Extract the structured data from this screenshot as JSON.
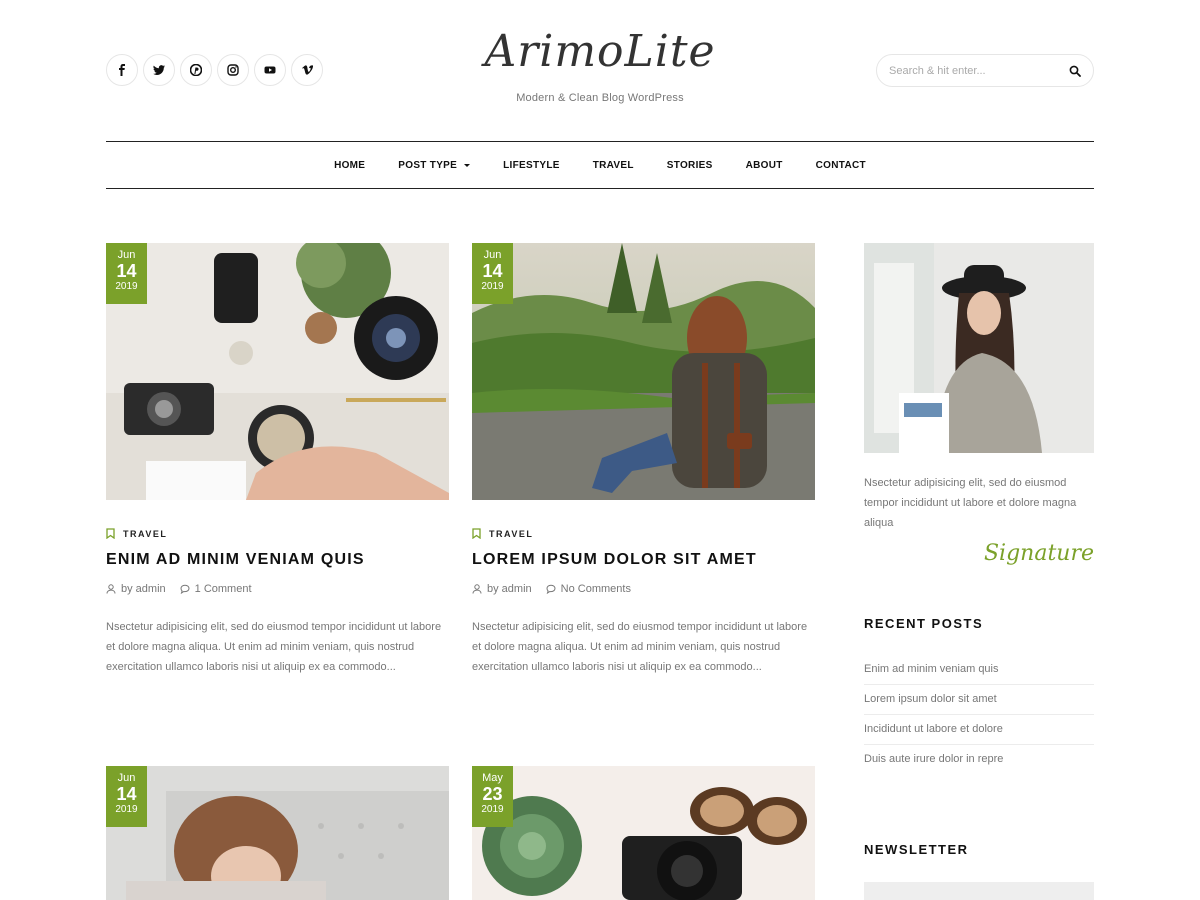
{
  "header": {
    "socials": [
      {
        "icon": "facebook-icon",
        "glyph": "f"
      },
      {
        "icon": "twitter-icon",
        "glyph": "t"
      },
      {
        "icon": "pinterest-icon",
        "glyph": "p"
      },
      {
        "icon": "instagram-icon",
        "glyph": "i"
      },
      {
        "icon": "youtube-icon",
        "glyph": "y"
      },
      {
        "icon": "vimeo-icon",
        "glyph": "v"
      }
    ],
    "logo": "ArimoLite",
    "tagline": "Modern & Clean Blog WordPress",
    "search_placeholder": "Search & hit enter..."
  },
  "nav": {
    "home": "HOME",
    "post_type": "POST TYPE",
    "lifestyle": "LIFESTYLE",
    "travel": "TRAVEL",
    "stories": "STORIES",
    "about": "ABOUT",
    "contact": "CONTACT"
  },
  "posts": [
    {
      "month": "Jun",
      "day": "14",
      "year": "2019",
      "category": "TRAVEL",
      "title": "ENIM AD MINIM VENIAM QUIS",
      "author": "by admin",
      "comments": "1 Comment",
      "excerpt": "Nsectetur adipisicing elit, sed do eiusmod tempor incididunt ut labore et dolore magna aliqua. Ut enim ad minim veniam, quis nostrud exercitation ullamco laboris nisi ut aliquip ex ea commodo..."
    },
    {
      "month": "Jun",
      "day": "14",
      "year": "2019",
      "category": "TRAVEL",
      "title": "LOREM IPSUM DOLOR SIT AMET",
      "author": "by admin",
      "comments": "No Comments",
      "excerpt": "Nsectetur adipisicing elit, sed do eiusmod tempor incididunt ut labore et dolore magna aliqua. Ut enim ad minim veniam, quis nostrud exercitation ullamco laboris nisi ut aliquip ex ea commodo..."
    },
    {
      "month": "Jun",
      "day": "14",
      "year": "2019"
    },
    {
      "month": "May",
      "day": "23",
      "year": "2019"
    }
  ],
  "sidebar": {
    "about_text": "Nsectetur adipisicing elit, sed do eiusmod tempor incididunt ut labore et dolore magna aliqua",
    "signature": "Signature",
    "recent_title": "RECENT POSTS",
    "recent": [
      "Enim ad minim veniam quis",
      "Lorem ipsum dolor sit amet",
      "Incididunt ut labore et dolore",
      "Duis aute irure dolor in repre"
    ],
    "newsletter_title": "NEWSLETTER"
  },
  "colors": {
    "accent": "#7ba12a",
    "text": "#111111",
    "muted": "#777777"
  }
}
